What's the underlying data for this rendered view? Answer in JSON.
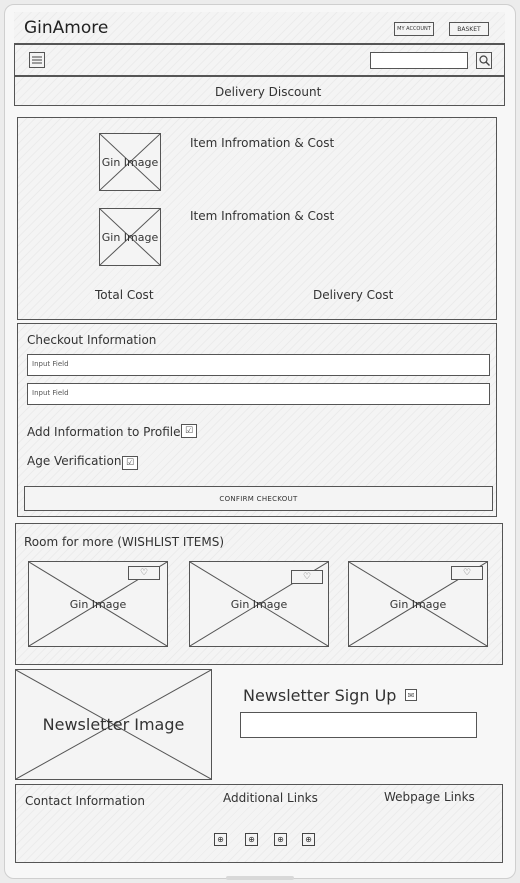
{
  "header": {
    "brand": "GinAmore",
    "account_label": "MY ACCOUNT",
    "basket_label": "BASKET",
    "menu_icon": "hamburger-menu-icon",
    "search_icon": "magnifier-icon",
    "search_value": ""
  },
  "banner": {
    "text": "Delivery Discount"
  },
  "basket": {
    "items": [
      {
        "image_label": "Gin Image",
        "info": "Item Infromation & Cost"
      },
      {
        "image_label": "Gin Image",
        "info": "Item Infromation & Cost"
      }
    ],
    "total_label": "Total Cost",
    "delivery_label": "Delivery Cost"
  },
  "checkout": {
    "title": "Checkout Information",
    "fields": [
      {
        "placeholder": "Input Field"
      },
      {
        "placeholder": "Input Field"
      }
    ],
    "add_profile_label": "Add Information to Profile",
    "age_label": "Age Verification",
    "checkbox_icon": "checked-box-icon",
    "confirm_label": "CONFIRM CHECKOUT"
  },
  "wishlist": {
    "title": "Room for more (WISHLIST ITEMS)",
    "items": [
      {
        "image_label": "Gin Image",
        "icon": "heart-icon"
      },
      {
        "image_label": "Gin Image",
        "icon": "heart-icon"
      },
      {
        "image_label": "Gin Image",
        "icon": "heart-icon"
      }
    ]
  },
  "newsletter": {
    "image_label": "Newsletter Image",
    "title": "Newsletter Sign Up",
    "title_icon": "envelope-icon",
    "input_value": ""
  },
  "footer": {
    "contact": "Contact Information",
    "additional": "Additional Links",
    "webpage": "Webpage Links",
    "social_icons": [
      "social-icon-1",
      "social-icon-2",
      "social-icon-3",
      "social-icon-4"
    ]
  }
}
